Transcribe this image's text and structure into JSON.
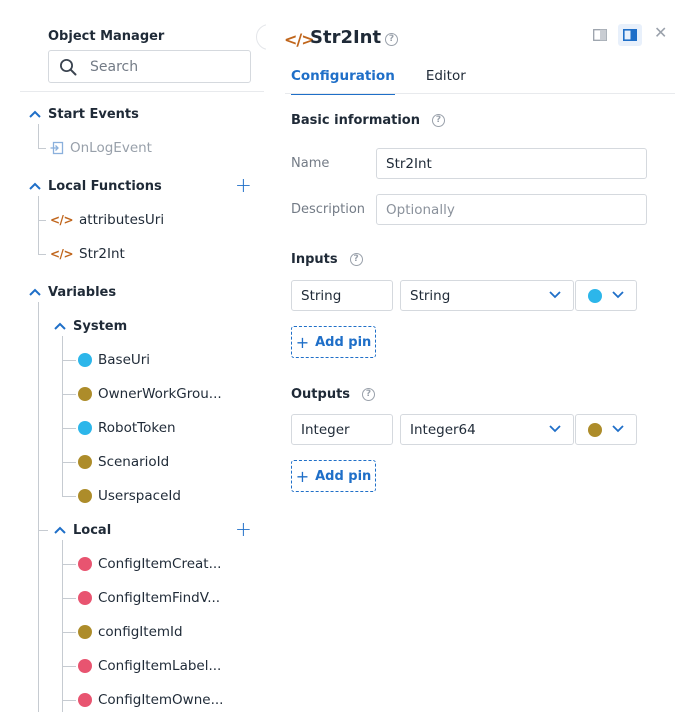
{
  "object_manager": {
    "title": "Object Manager",
    "search_placeholder": "Search",
    "sections": {
      "start_events": {
        "label": "Start Events",
        "items": [
          "OnLogEvent"
        ]
      },
      "local_functions": {
        "label": "Local Functions",
        "items": [
          "attributesUri",
          "Str2Int"
        ]
      },
      "variables": {
        "label": "Variables",
        "system": {
          "label": "System",
          "items": [
            {
              "name": "BaseUri",
              "color": "#2cb6ea"
            },
            {
              "name": "OwnerWorkGrou...",
              "color": "#ad8c2a"
            },
            {
              "name": "RobotToken",
              "color": "#2cb6ea"
            },
            {
              "name": "ScenarioId",
              "color": "#ad8c2a"
            },
            {
              "name": "UserspaceId",
              "color": "#ad8c2a"
            }
          ]
        },
        "local": {
          "label": "Local",
          "items": [
            {
              "name": "ConfigItemCreat...",
              "color": "#e85470"
            },
            {
              "name": "ConfigItemFindV...",
              "color": "#e85470"
            },
            {
              "name": "configItemId",
              "color": "#ad8c2a"
            },
            {
              "name": "ConfigItemLabel...",
              "color": "#e85470"
            },
            {
              "name": "ConfigItemOwne...",
              "color": "#e85470"
            }
          ]
        }
      }
    }
  },
  "function": {
    "icon": "code-icon",
    "title": "Str2Int",
    "tabs": [
      {
        "label": "Configuration",
        "active": true
      },
      {
        "label": "Editor",
        "active": false
      }
    ],
    "basic_information": {
      "label": "Basic information",
      "name_label": "Name",
      "name_value": "Str2Int",
      "description_label": "Description",
      "description_placeholder": "Optionally"
    },
    "inputs": {
      "label": "Inputs",
      "pins": [
        {
          "name": "String",
          "type": "String",
          "color": "#2cb6ea"
        }
      ],
      "add_label": "Add pin"
    },
    "outputs": {
      "label": "Outputs",
      "pins": [
        {
          "name": "Integer",
          "type": "Integer64",
          "color": "#ad8c2a"
        }
      ],
      "add_label": "Add pin"
    }
  },
  "colors": {
    "accent": "#1f6fc8",
    "function_icon": "#c0651b"
  }
}
